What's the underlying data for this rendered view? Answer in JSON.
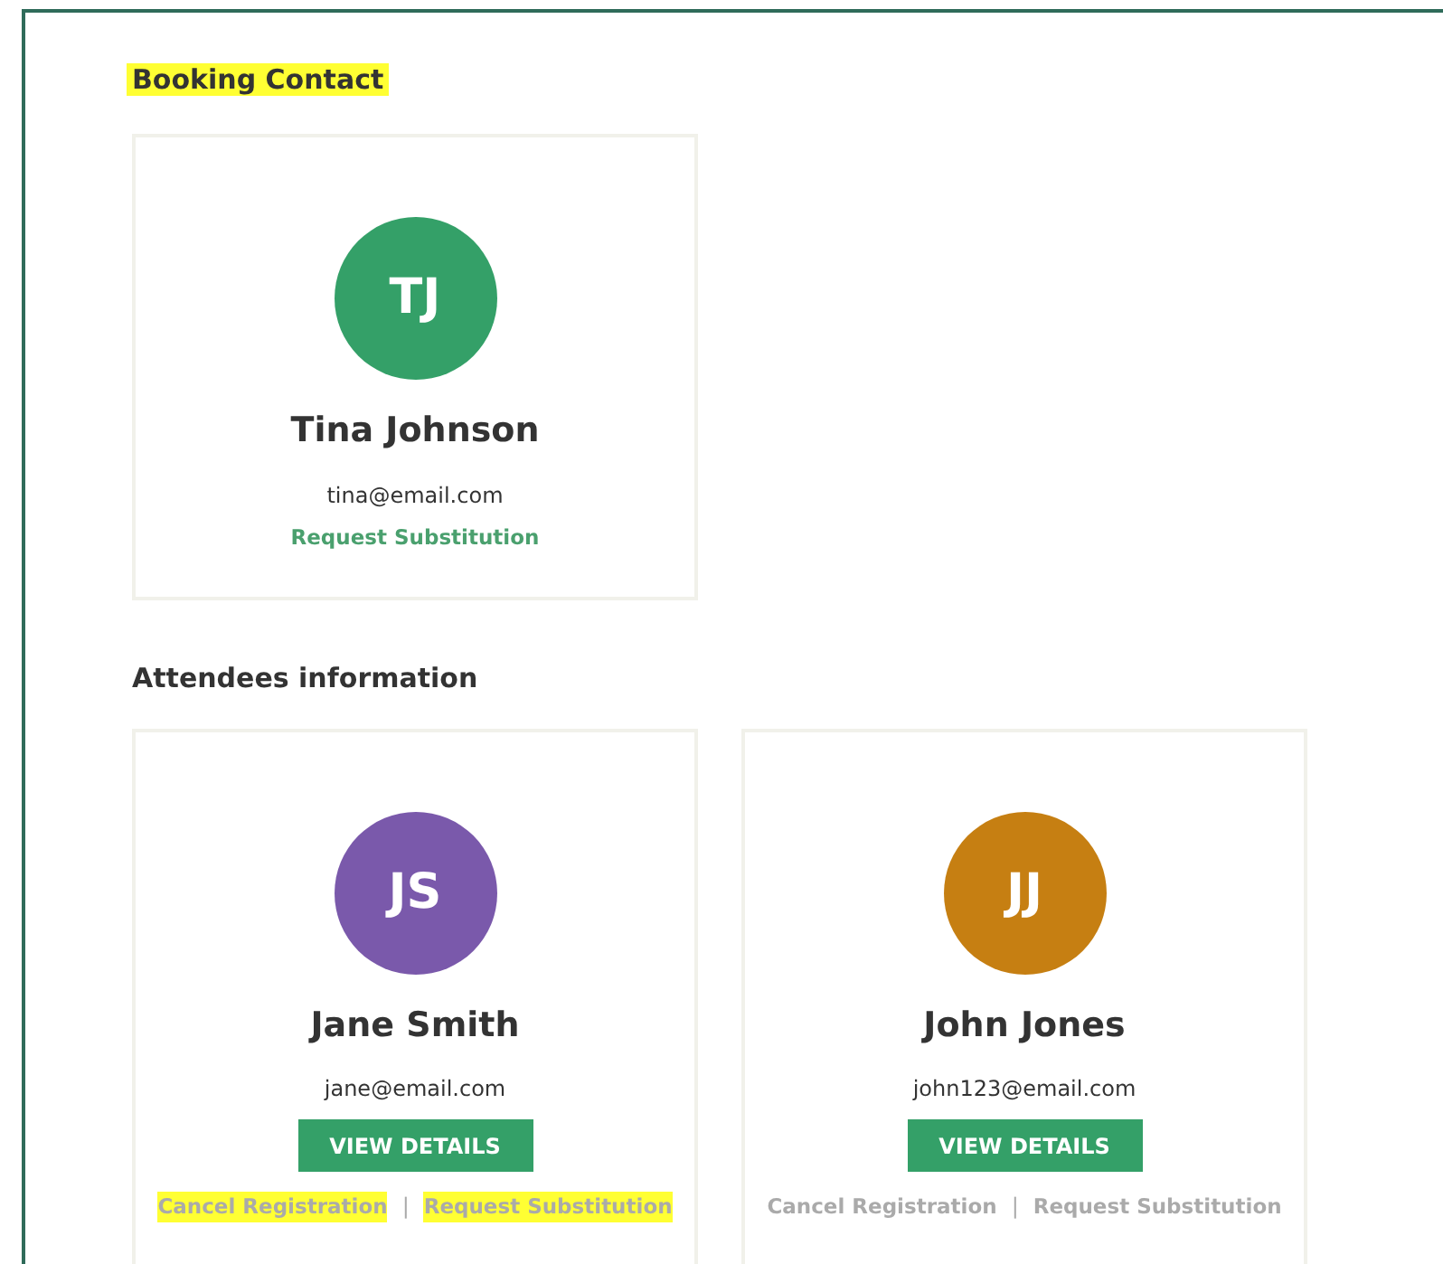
{
  "sections": [
    {
      "heading": "Booking Contact",
      "highlighted": true,
      "people": [
        {
          "initials": "TJ",
          "color": "#34a068",
          "name": "Tina Johnson",
          "email": "tina@email.com",
          "links": [
            {
              "label": "Request Substitution",
              "disabled": false,
              "highlighted": false
            }
          ]
        }
      ]
    },
    {
      "heading": "Attendees information",
      "highlighted": false,
      "people": [
        {
          "initials": "JS",
          "color": "#7a59ab",
          "name": "Jane Smith",
          "email": "jane@email.com",
          "button": "VIEW DETAILS",
          "links": [
            {
              "label": "Cancel Registration",
              "disabled": true,
              "highlighted": true
            },
            {
              "label": "Request Substitution",
              "disabled": true,
              "highlighted": true
            }
          ],
          "separator": "|"
        },
        {
          "initials": "JJ",
          "color": "#c67f12",
          "name": "John Jones",
          "email": "john123@email.com",
          "button": "VIEW DETAILS",
          "links": [
            {
              "label": "Cancel Registration",
              "disabled": true,
              "highlighted": false
            },
            {
              "label": "Request Substitution",
              "disabled": true,
              "highlighted": false
            }
          ],
          "separator": "|"
        }
      ]
    }
  ]
}
